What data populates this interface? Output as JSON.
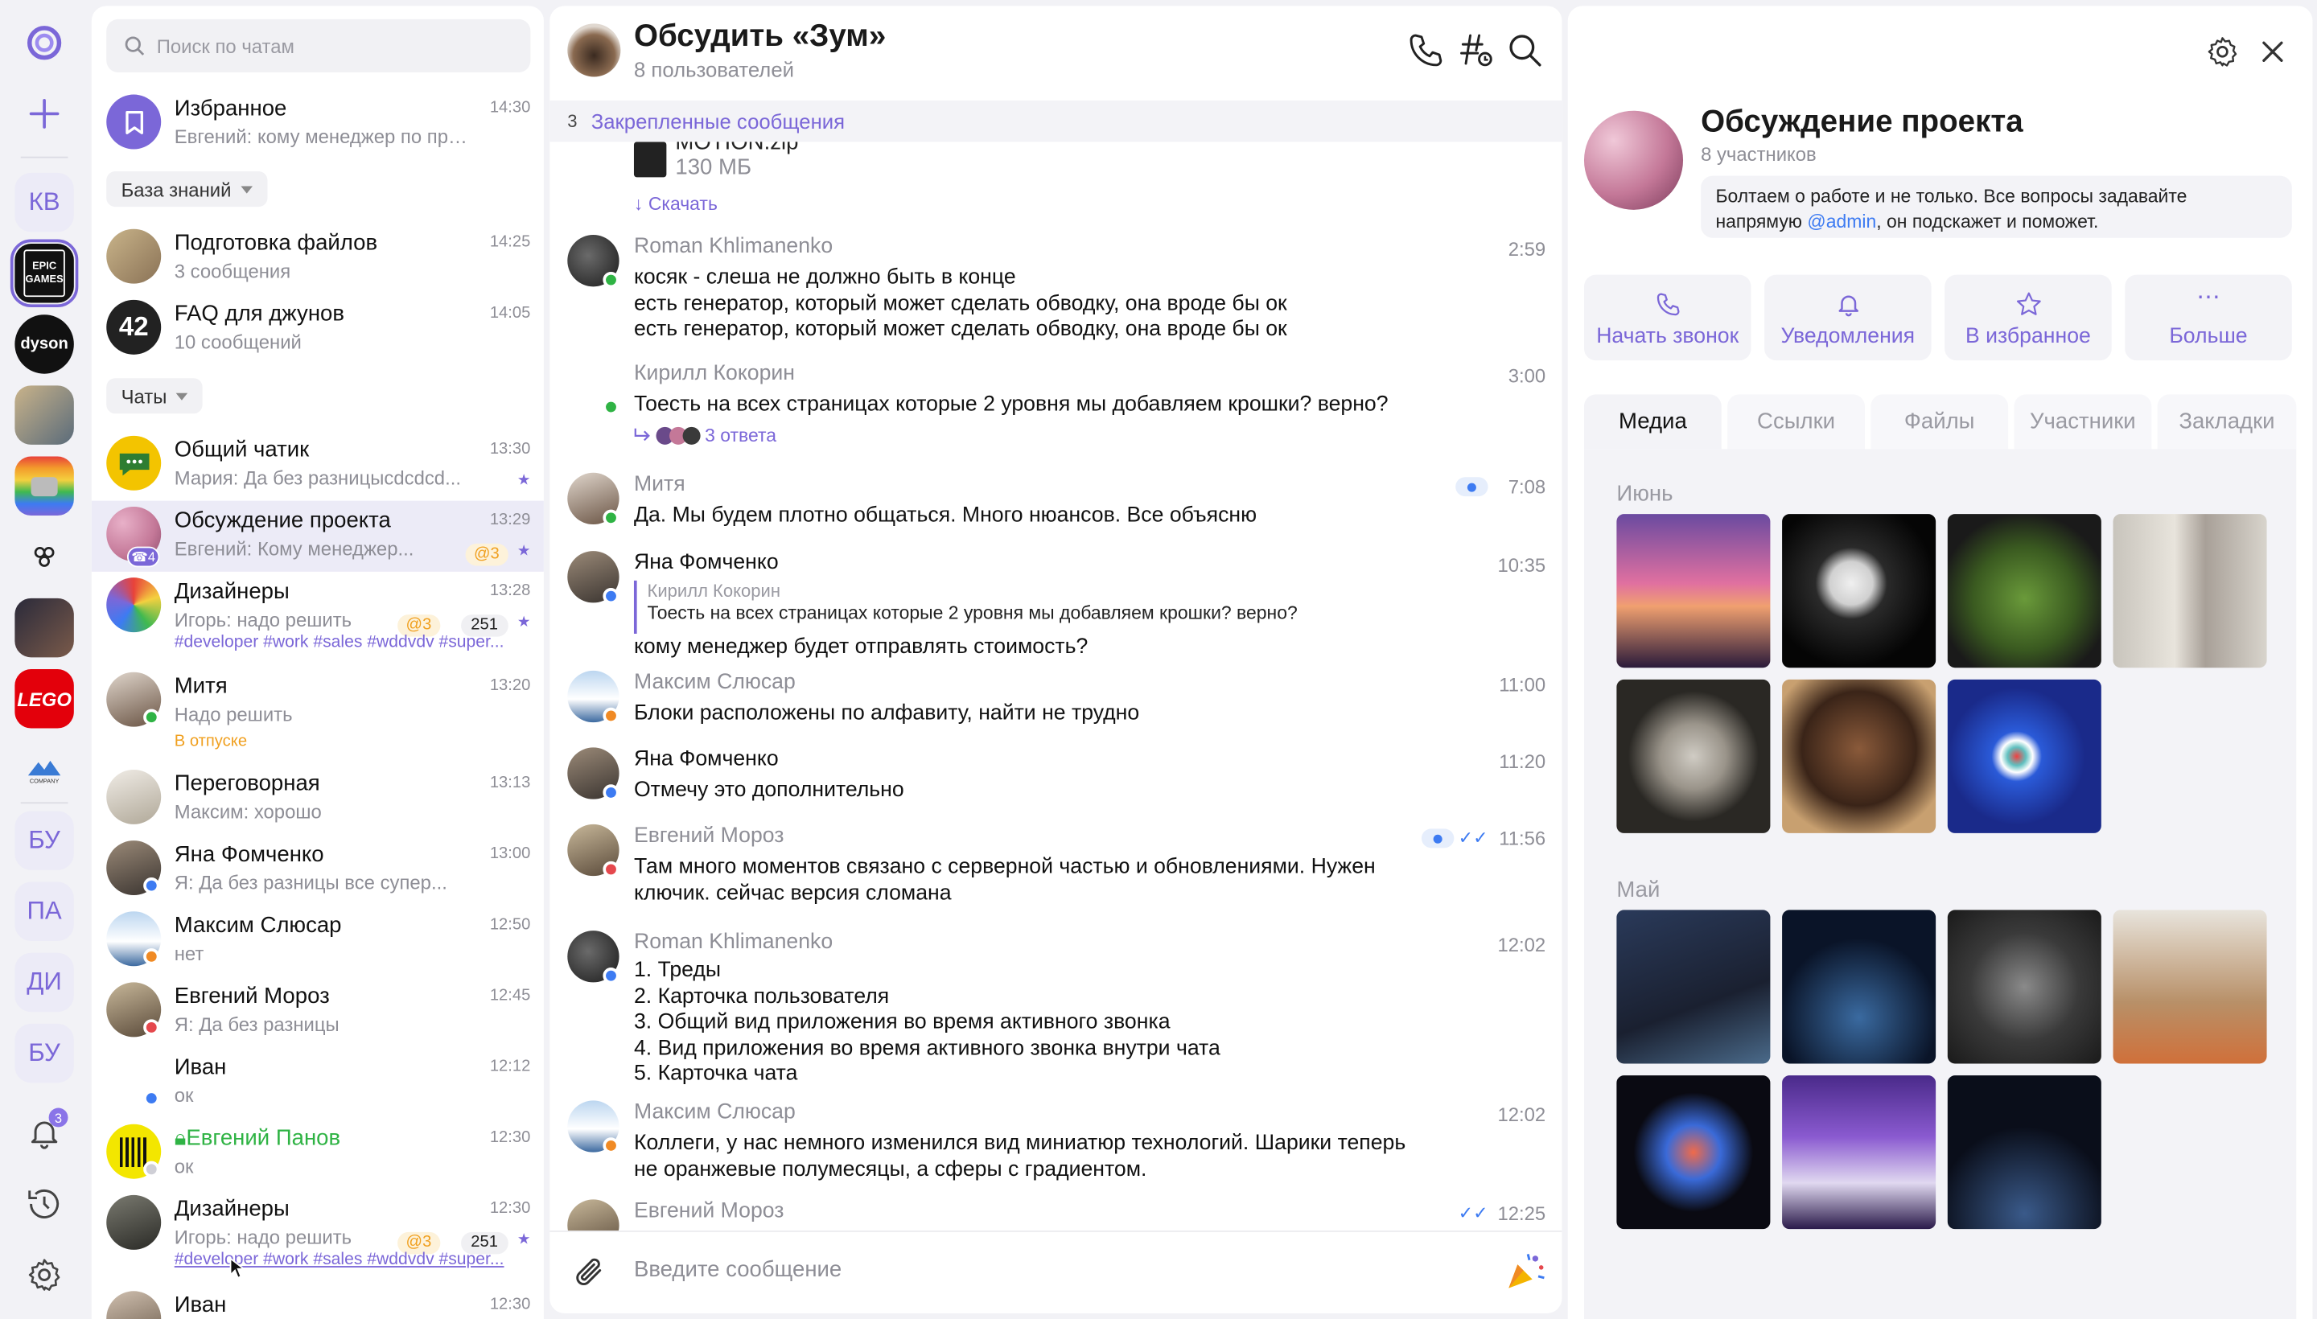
{
  "colors": {
    "accent": "#7b67d8",
    "online": "#2fb344",
    "away": "#f08a24",
    "busy": "#e5484d",
    "info": "#3d7bf2"
  },
  "rail": {
    "workspaces": [
      "КВ",
      "БУ",
      "ПА",
      "ДИ",
      "БУ"
    ],
    "logos": {
      "epic": "EPIC GAMES",
      "dyson": "dyson",
      "lego": "LEGO",
      "company": "COMPANY"
    },
    "notifications_count": "3"
  },
  "list": {
    "search_placeholder": "Поиск по чатам",
    "favorites": {
      "name": "Избранное",
      "sub": "Евгений: кому менеджер по про...",
      "time": "14:30"
    },
    "section_kb": "База знаний",
    "kb_items": [
      {
        "name": "Подготовка файлов",
        "sub": "3 сообщения",
        "time": "14:25"
      },
      {
        "name": "FAQ для джунов",
        "sub": "10 сообщений",
        "time": "14:05"
      }
    ],
    "section_chats": "Чаты",
    "chats": [
      {
        "name": "Общий чатик",
        "sub": "Мария: Да без разницысdcdcd...",
        "time": "13:30"
      },
      {
        "name": "Обсуждение проекта",
        "sub": "Евгений: Кому менеджер...",
        "time": "13:29",
        "mention": "@3",
        "call_badge": "4"
      },
      {
        "name": "Дизайнеры",
        "sub": "Игорь: надо решить",
        "time": "13:28",
        "mention": "@3",
        "count": "251",
        "tags": "#developer #work #sales #wddvdv #super..."
      },
      {
        "name": "Митя",
        "sub": "Надо решить",
        "time": "13:20",
        "status": "В отпуске"
      },
      {
        "name": "Переговорная",
        "sub": "Максим: хорошо",
        "time": "13:13"
      },
      {
        "name": "Яна Фомченко",
        "sub": "Я: Да без разницы все супер...",
        "time": "13:00"
      },
      {
        "name": "Максим Слюсар",
        "sub": "нет",
        "time": "12:50"
      },
      {
        "name": "Евгений Мороз",
        "sub": "Я: Да без разницы",
        "time": "12:45"
      },
      {
        "name": "Иван",
        "sub": "ок",
        "time": "12:12"
      },
      {
        "name": "Евгений Панов",
        "sub": "ок",
        "time": "12:30"
      },
      {
        "name": "Дизайнеры",
        "sub": "Игорь: надо решить",
        "time": "12:30",
        "mention": "@3",
        "count": "251",
        "tags": "#developer #work #sales #wddvdv #super..."
      },
      {
        "name": "Иван",
        "sub": "",
        "time": "12:30"
      }
    ]
  },
  "conversation": {
    "title": "Обсудить «Зум»",
    "subtitle": "8 пользователей",
    "pinned_count": "3",
    "pinned_label": "Закрепленные сообщения",
    "file": {
      "name": "MOTION.zip",
      "size": "130 МБ",
      "download": "↓ Скачать"
    },
    "messages": [
      {
        "author": "Roman Khlimanenko",
        "time": "2:59",
        "text": "косяк - слеша не должно быть в конце\nесть генератор, который может сделать обводку, она вроде бы ок\nесть генератор, который может сделать обводку, она вроде бы ок"
      },
      {
        "author": "Кирилл Кокорин",
        "time": "3:00",
        "text": "Тоесть на всех страницах которые 2 уровня мы добавляем крошки? верно?",
        "replies": "3 ответа"
      },
      {
        "author": "Митя",
        "time": "7:08",
        "text": "Да. Мы будем плотно общаться. Много нюансов. Все объясню"
      },
      {
        "author": "Яна Фомченко",
        "time": "10:35",
        "quote_author": "Кирилл Кокорин",
        "quote_text": "Тоесть на всех страницах которые 2 уровня мы добавляем крошки? верно?",
        "text": "кому менеджер будет отправлять стоимость?"
      },
      {
        "author": "Максим Слюсар",
        "time": "11:00",
        "text": "Блоки расположены по алфавиту, найти не трудно"
      },
      {
        "author": "Яна Фомченко",
        "time": "11:20",
        "text": "Отмечу это дополнительно"
      },
      {
        "author": "Евгений Мороз",
        "time": "11:56",
        "text": "Там много моментов связано с серверной частью и обновлениями. Нужен\nключик. сейчас версия сломана"
      },
      {
        "author": "Roman Khlimanenko",
        "time": "12:02",
        "text": "1. Треды\n2. Карточка пользователя\n3. Общий вид приложения во время активного звонка\n4. Вид приложения во время активного звонка внутри чата\n5. Карточка чата"
      },
      {
        "author": "Максим Слюсар",
        "time": "12:02",
        "text": "Коллеги, у нас немного изменился вид миниатюр технологий. Шарики теперь\nне оранжевые полумесяцы, а сферы с градиентом."
      },
      {
        "author": "Евгений Мороз",
        "time": "12:25",
        "text": ""
      }
    ],
    "composer_placeholder": "Введите сообщение"
  },
  "panel": {
    "title": "Обсуждение проекта",
    "subtitle": "8 участников",
    "desc_before": "Болтаем о работе и не только. Все вопросы задавайте напрямую ",
    "desc_link": "@admin",
    "desc_after": ", он подскажет и поможет.",
    "actions": [
      "Начать звонок",
      "Уведомления",
      "В избранное",
      "Больше"
    ],
    "tabs": [
      "Медиа",
      "Ссылки",
      "Файлы",
      "Участники",
      "Закладки"
    ],
    "months": [
      "Июнь",
      "Май"
    ]
  }
}
